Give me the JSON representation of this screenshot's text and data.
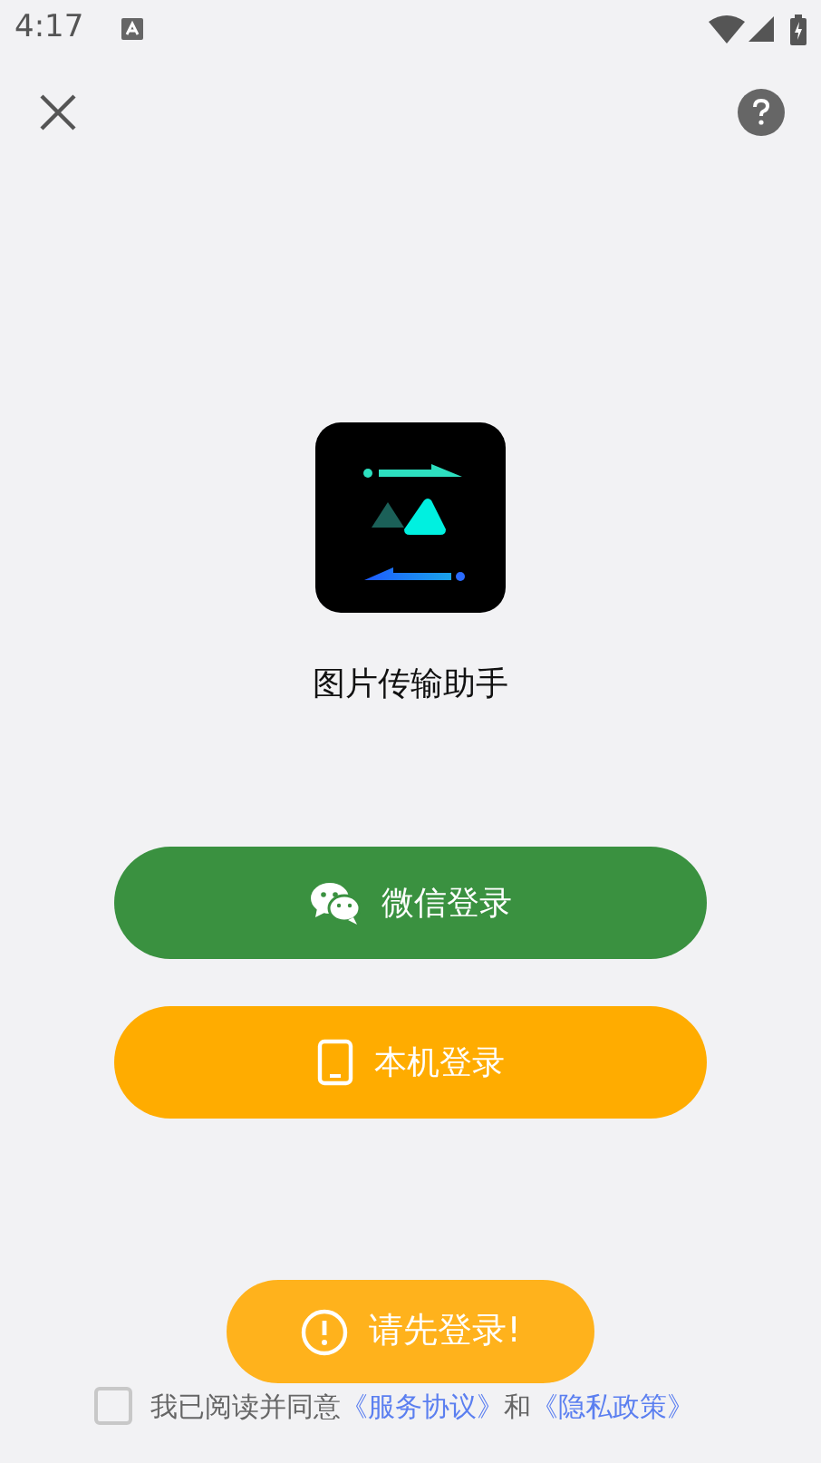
{
  "status_bar": {
    "time": "4:17"
  },
  "app": {
    "name": "图片传输助手"
  },
  "buttons": [
    {
      "kind": "wechat",
      "label": "微信登录"
    },
    {
      "kind": "phone",
      "label": "本机登录"
    }
  ],
  "agreement": {
    "checked": false,
    "prefix": "我已阅读并同意",
    "link_1": "《服务协议》",
    "middle": "和",
    "link_2": "《隐私政策》"
  },
  "toast": {
    "message": "请先登录!"
  }
}
